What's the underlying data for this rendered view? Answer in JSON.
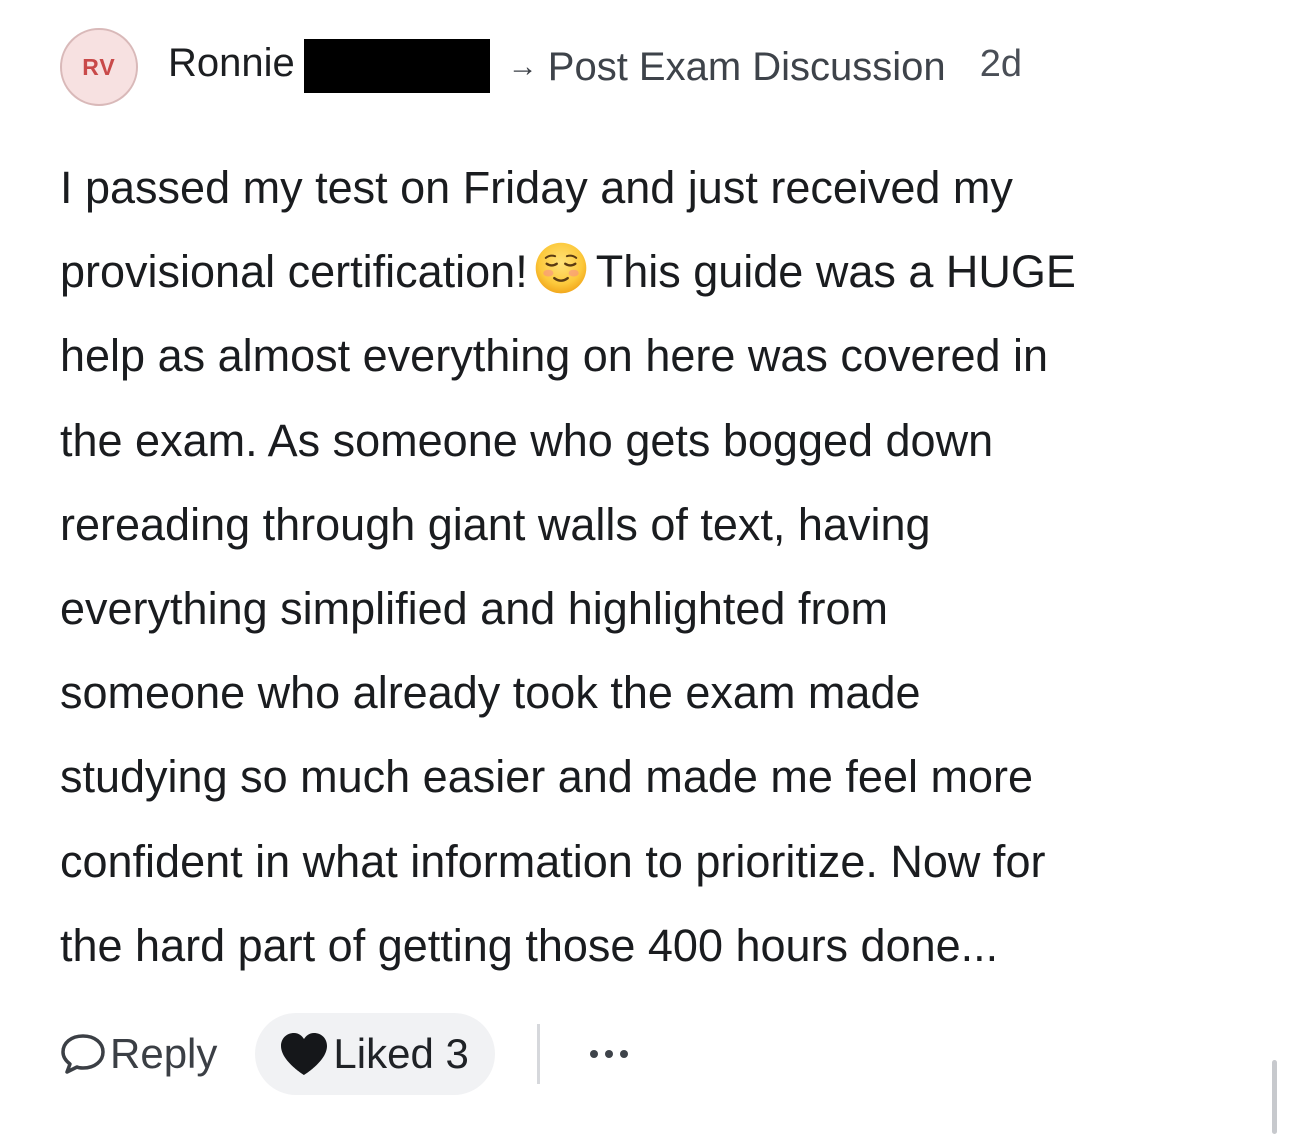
{
  "post": {
    "author": {
      "initials": "RV",
      "name": "Ronnie"
    },
    "arrow": "→",
    "space": "Post Exam Discussion",
    "time": "2d",
    "body_lines": [
      "I passed my test on Friday and just received my",
      "provisional certification!",
      "This guide was a HUGE",
      "help as almost everything on here was covered in",
      "the exam. As someone who gets bogged down",
      "rereading through giant walls of text, having",
      "everything simplified and highlighted from",
      "someone who already took the exam made",
      "studying so much easier and made me feel more",
      "confident in what information to prioritize. Now for",
      "the hard part of getting those 400 hours done..."
    ],
    "emoji": "relieved-smiling-face-emoji"
  },
  "actions": {
    "reply_label": "Reply",
    "like_label": "Liked 3",
    "more_icon": "ellipsis-icon"
  },
  "colors": {
    "avatar_bg": "#f7e1e1",
    "avatar_text": "#c94a4a",
    "like_bg": "#f1f2f4",
    "redaction": "#000000"
  }
}
